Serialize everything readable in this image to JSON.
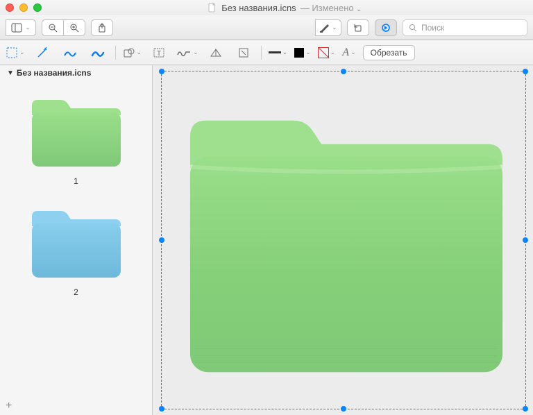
{
  "window": {
    "filename": "Без названия.icns",
    "modified_label": "Изменено"
  },
  "toolbar": {
    "search_placeholder": "Поиск"
  },
  "editbar": {
    "crop_label": "Обрезать"
  },
  "sidebar": {
    "filename": "Без названия.icns",
    "thumbs": [
      {
        "label": "1",
        "color": "green"
      },
      {
        "label": "2",
        "color": "blue"
      }
    ]
  },
  "canvas": {
    "folder_color": "green"
  },
  "colors": {
    "green_tab": "#9fe08f",
    "green_body_top": "#9ade8a",
    "green_body_bottom": "#7fc978",
    "blue_tab": "#8ed0ef",
    "blue_body_top": "#88cdec",
    "blue_body_bottom": "#6db9db",
    "selection_handle": "#0a84ff",
    "accent": "#107aee"
  }
}
